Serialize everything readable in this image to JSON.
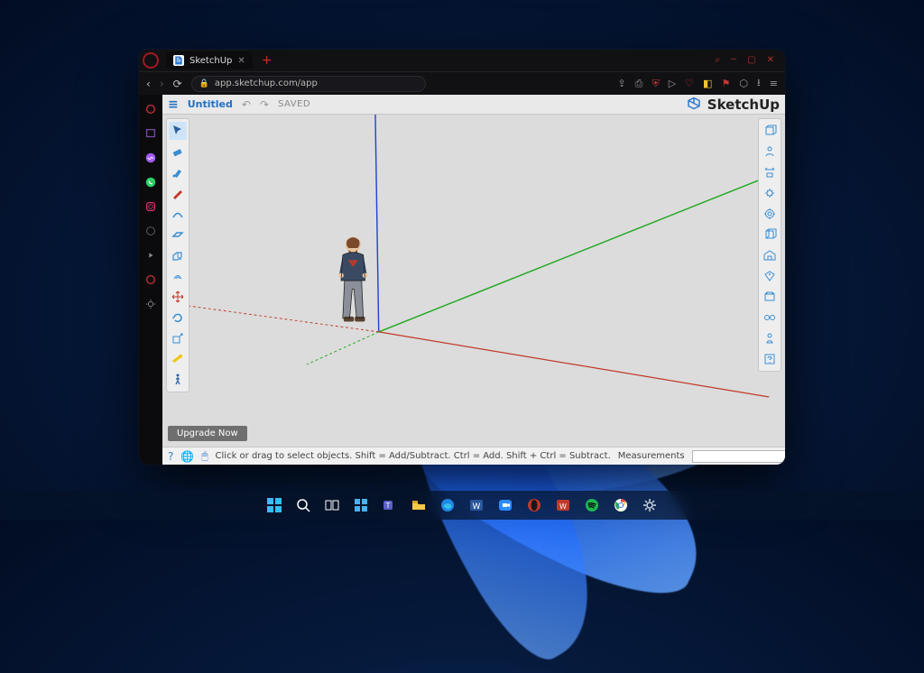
{
  "browser": {
    "tab": {
      "title": "SketchUp"
    },
    "url": "app.sketchup.com/app",
    "window_controls": {
      "search": "⌕",
      "minimize": "—",
      "maximize": "▢",
      "close": "✕"
    }
  },
  "opera_sidebar": {
    "items": [
      "music",
      "twitch",
      "messenger",
      "whatsapp",
      "instagram",
      "gx",
      "video",
      "cart",
      "settings"
    ]
  },
  "sketchup": {
    "header": {
      "title": "Untitled",
      "saved": "SAVED",
      "logo_text": "SketchUp"
    },
    "left_tools": [
      "select",
      "eraser",
      "paint",
      "pencil",
      "arc",
      "rectangle",
      "pushpull",
      "offset",
      "move",
      "rotate",
      "scale",
      "tape",
      "walk"
    ],
    "right_tools": [
      "orbit",
      "pan",
      "zoom",
      "settings",
      "layers",
      "outliner",
      "3dwarehouse",
      "extensions",
      "tag",
      "scenes",
      "display",
      "styles",
      "help"
    ],
    "upgrade_label": "Upgrade Now",
    "status": {
      "hint": "Click or drag to select objects. Shift = Add/Subtract. Ctrl = Add. Shift + Ctrl = Subtract.",
      "measurements_label": "Measurements",
      "measurements_value": ""
    }
  },
  "taskbar": {
    "items": [
      "start",
      "search",
      "taskview",
      "widgets",
      "teams",
      "explorer",
      "edge",
      "word",
      "zoom",
      "opera",
      "wps",
      "spotify",
      "chrome",
      "settings"
    ]
  }
}
